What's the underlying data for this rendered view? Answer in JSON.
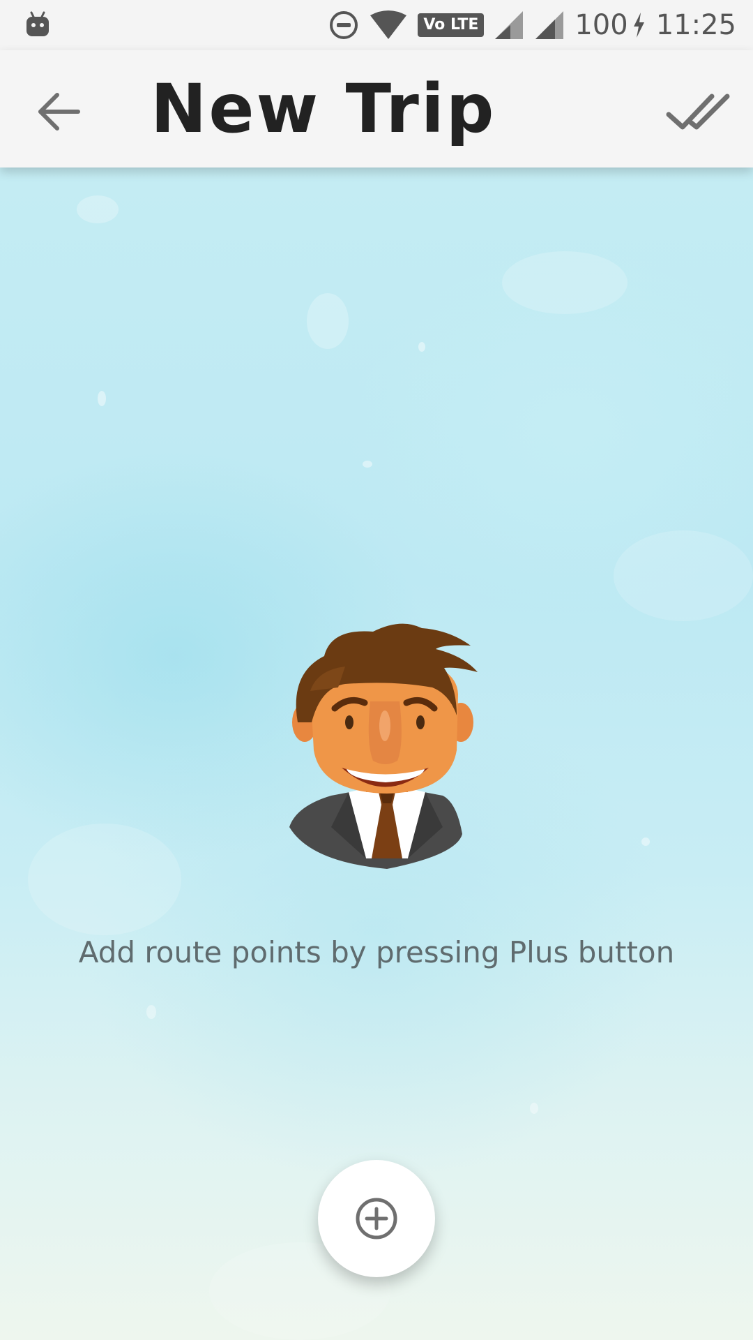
{
  "status_bar": {
    "notification_icon": "android-robot-icon",
    "do_not_disturb_icon": "dnd-icon",
    "wifi_icon": "wifi-icon",
    "volte_label": "Vo LTE",
    "signal_icon": "signal-icon",
    "battery_level": "100",
    "charging_icon": "charging-bolt-icon",
    "clock": "11:25"
  },
  "app_bar": {
    "back_icon": "arrow-back-icon",
    "title": "New Trip",
    "done_icon": "double-check-icon"
  },
  "main": {
    "illustration": "businessman-avatar",
    "empty_message": "Add route points by pressing Plus button",
    "fab_icon": "plus-circle-icon"
  },
  "colors": {
    "app_bar_background": "#f5f5f5",
    "background_water": "#c4ecf3",
    "text_primary": "#222222",
    "text_secondary": "#5f6b6e",
    "icon_grey": "#6f6f6f",
    "fab_background": "#ffffff"
  }
}
